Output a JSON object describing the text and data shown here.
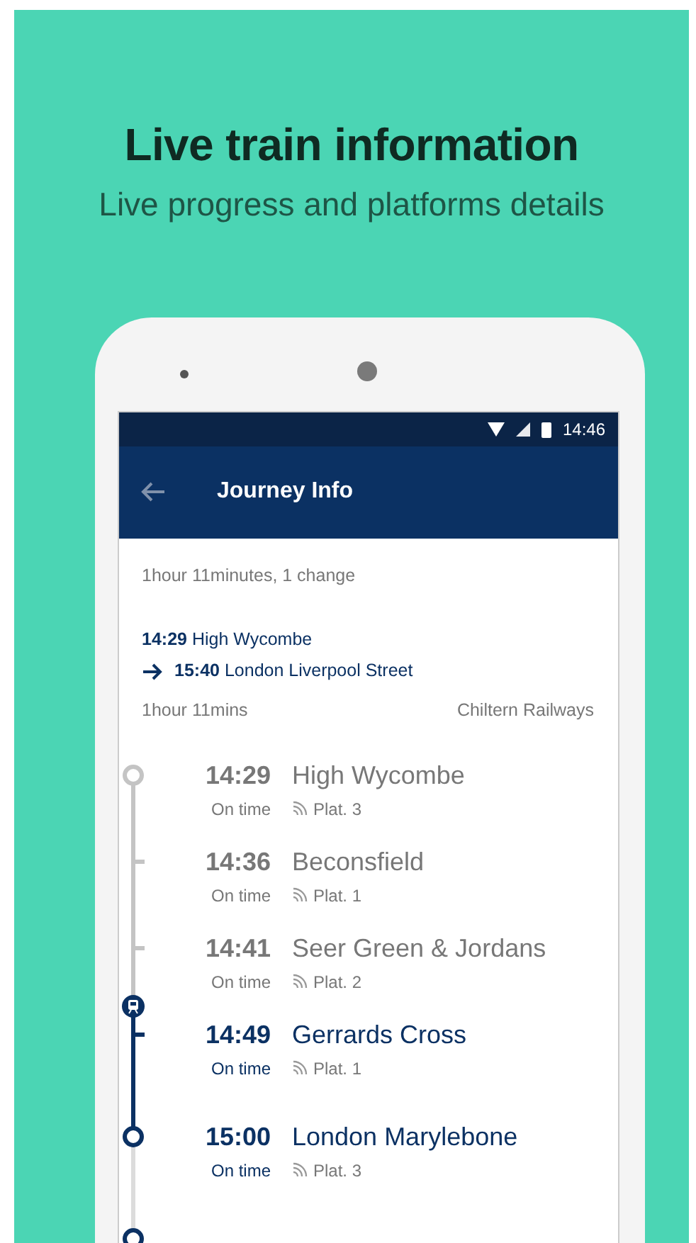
{
  "headline": "Live train information",
  "subheadline": "Live progress and platforms details",
  "status_bar": {
    "time": "14:46"
  },
  "app_bar": {
    "title": "Journey Info"
  },
  "journey": {
    "summary": "1hour 11minutes, 1 change",
    "departure": {
      "time": "14:29",
      "station": "High Wycombe"
    },
    "arrival": {
      "time": "15:40",
      "station": "London Liverpool Street"
    },
    "duration": "1hour 11mins",
    "operator": "Chiltern Railways"
  },
  "stops": [
    {
      "kind": "terminal",
      "time": "14:29",
      "station": "High Wycombe",
      "status": "On time",
      "platform": "Plat. 3",
      "passed": true,
      "current_leg": true,
      "train_here": false
    },
    {
      "kind": "intermediate",
      "time": "14:36",
      "station": "Beconsfield",
      "status": "On time",
      "platform": "Plat. 1",
      "passed": true,
      "current_leg": true,
      "train_here": false
    },
    {
      "kind": "intermediate",
      "time": "14:41",
      "station": "Seer Green & Jordans",
      "status": "On time",
      "platform": "Plat. 2",
      "passed": true,
      "current_leg": true,
      "train_here": true
    },
    {
      "kind": "intermediate",
      "time": "14:49",
      "station": "Gerrards Cross",
      "status": "On time",
      "platform": "Plat. 1",
      "passed": false,
      "current_leg": true,
      "train_here": false
    },
    {
      "kind": "terminal",
      "time": "15:00",
      "station": "London Marylebone",
      "status": "On time",
      "platform": "Plat. 3",
      "passed": false,
      "current_leg": true,
      "train_here": false
    },
    {
      "kind": "terminal",
      "passed": false,
      "current_leg": false,
      "train_here": false
    }
  ]
}
